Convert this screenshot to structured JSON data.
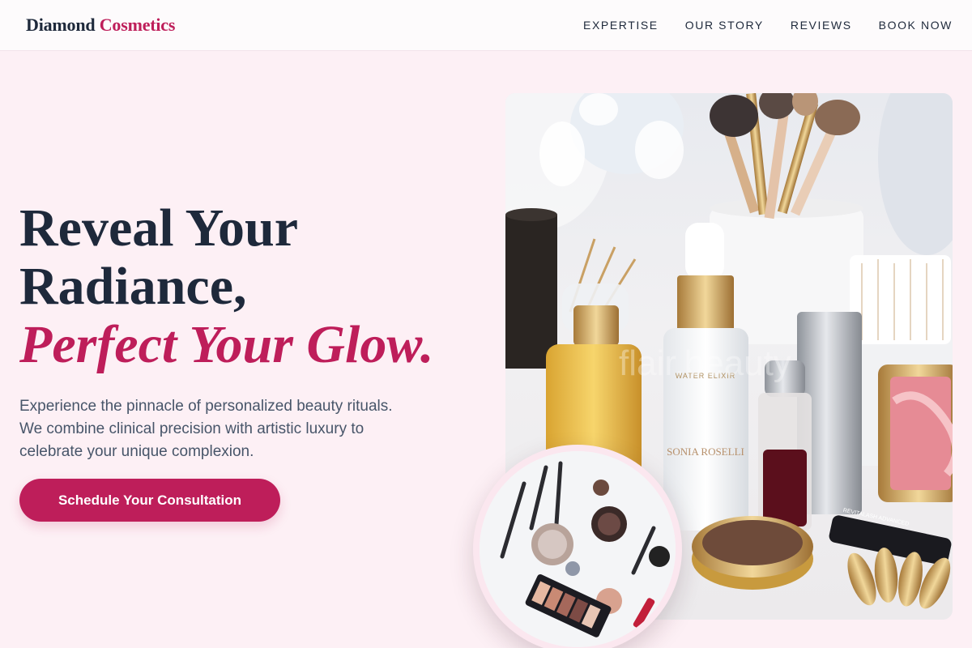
{
  "header": {
    "brand_part1": "Diamond",
    "brand_part2": "Cosmetics",
    "nav": [
      "EXPERTISE",
      "OUR STORY",
      "REVIEWS",
      "BOOK NOW"
    ]
  },
  "hero": {
    "title_line1": "Reveal Your",
    "title_line2": "Radiance,",
    "title_accent": "Perfect Your Glow.",
    "description": "Experience the pinnacle of personalized beauty rituals. We combine clinical precision with artistic luxury to celebrate your unique complexion.",
    "cta_label": "Schedule Your Consultation"
  },
  "photo": {
    "watermark": "flair.beauty",
    "bottle_label_1": "WATER ELIXIR",
    "bottle_label_2": "SONIA ROSELLI",
    "tube_label": "REVITALASH ADVANCED"
  },
  "colors": {
    "accent": "#be1e5a",
    "heading": "#1e293b",
    "body_text": "#475569",
    "background": "#fdf0f5"
  }
}
